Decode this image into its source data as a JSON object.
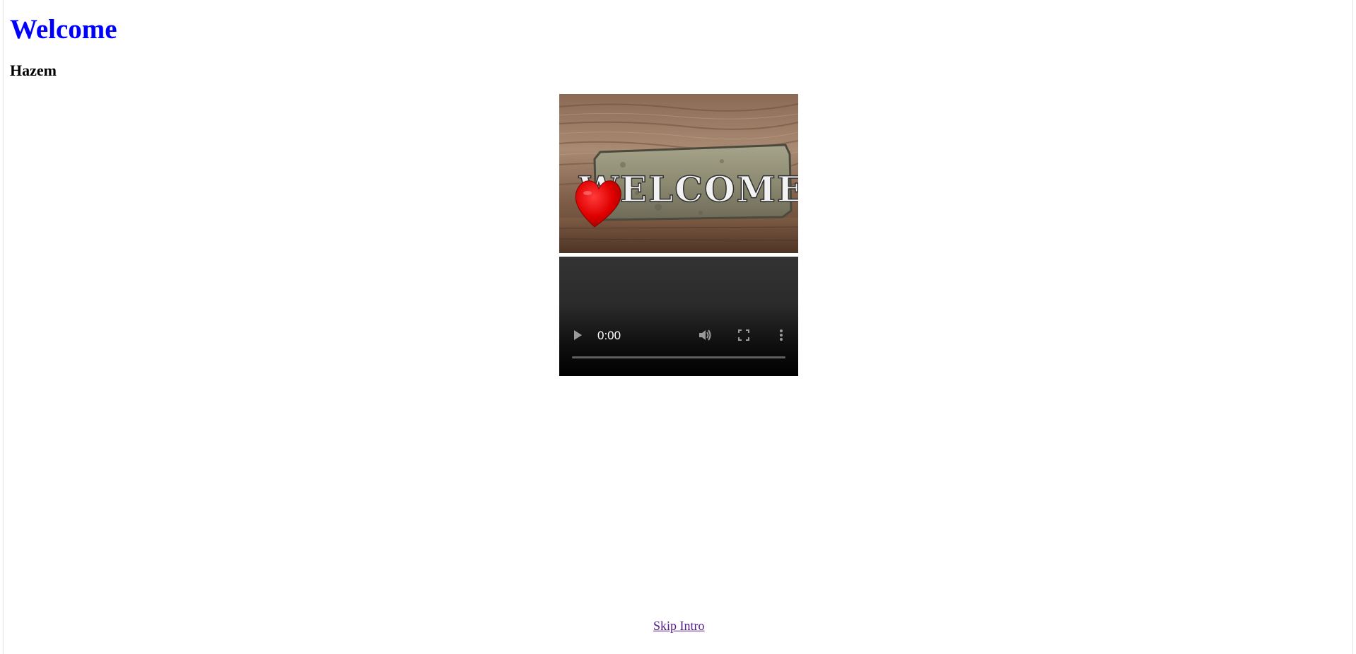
{
  "page": {
    "title": "Welcome",
    "user_name": "Hazem"
  },
  "image": {
    "sign_text": "WELCOME",
    "icon": "heart-icon"
  },
  "video": {
    "time": "0:00",
    "progress": 0,
    "icons": [
      "play-icon",
      "volume-icon",
      "fullscreen-icon",
      "more-vert-icon"
    ]
  },
  "links": {
    "skip_intro": "Skip Intro"
  },
  "colors": {
    "title": "#0000ff",
    "visited_link": "#551a8b",
    "heart": "#e00000"
  }
}
